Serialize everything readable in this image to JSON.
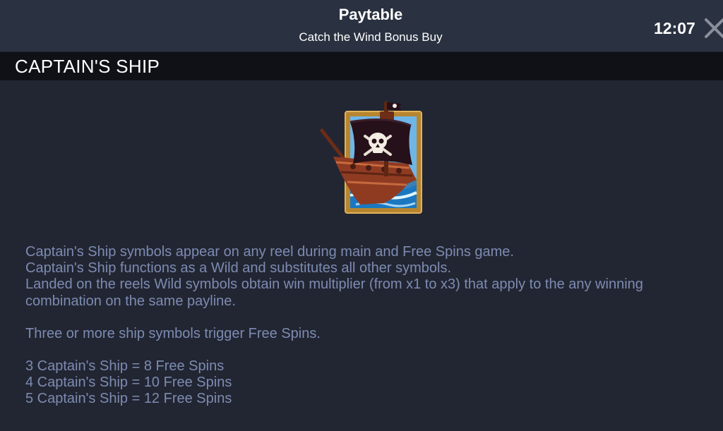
{
  "header": {
    "title": "Paytable",
    "subtitle": "Catch the Wind Bonus Buy",
    "clock": "12:07",
    "close_icon": "close-icon"
  },
  "section": {
    "title": "CAPTAIN'S SHIP",
    "symbol_icon": "pirate-ship-icon"
  },
  "description": {
    "lines": [
      "Captain's Ship symbols appear on any reel during main and Free Spins game.",
      "Captain's Ship functions as a Wild and substitutes all other symbols.",
      "Landed on the reels Wild symbols obtain win multiplier (from x1 to x3) that apply to the any winning combination on the same payline."
    ],
    "trigger": "Three or more ship symbols trigger Free Spins.",
    "payouts": [
      "3 Captain's Ship = 8 Free Spins",
      "4 Captain's Ship = 10 Free Spins",
      "5 Captain's Ship = 12 Free Spins"
    ]
  },
  "colors": {
    "background": "#222632",
    "topbar": "#2a3140",
    "section_header": "#0f1117",
    "body_text": "#7d8bb2"
  }
}
